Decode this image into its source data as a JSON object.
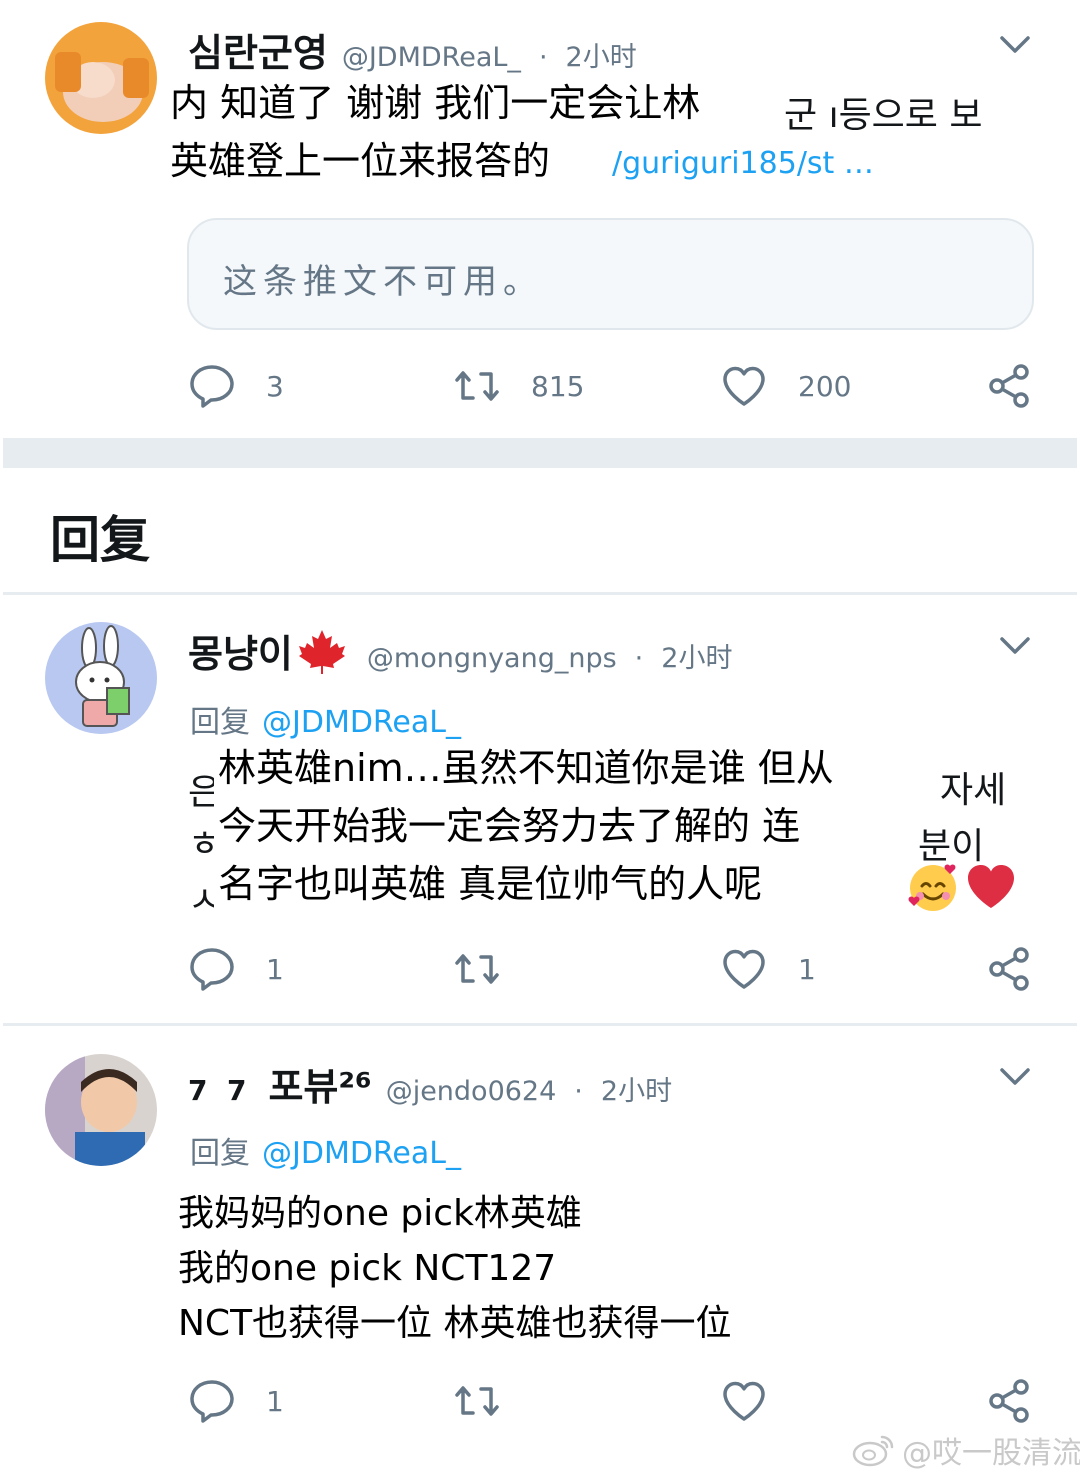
{
  "tweet1": {
    "name": "심란군영",
    "handle": "@JDMDReaL_",
    "dot": "·",
    "time": "2小时",
    "lines": [
      "内 知道了 谢谢 我们一定会让林",
      "英雄登上一位来报答的"
    ],
    "behind": [
      "군 ı등으로 보",
      "/guriguri185/st …"
    ],
    "unavailable": "这条推文不可用。",
    "replies": "3",
    "retweets": "815",
    "likes": "200"
  },
  "section": {
    "title": "回复"
  },
  "tweet2": {
    "name": "몽냥이",
    "handle": "@mongnyang_nps",
    "dot": "·",
    "time": "2小时",
    "reply_label": "回复",
    "reply_mention": "@JDMDReaL_",
    "lines": [
      "林英雄nim…虽然不知道你是谁 但从",
      "今天开始我一定会努力去了解的 连",
      "名字也叫英雄 真是位帅气的人呢"
    ],
    "behind_left": [
      "은",
      "ㅎ",
      "ㅅ"
    ],
    "behind_right": [
      "자세",
      "분이"
    ],
    "replies": "1",
    "likes": "1"
  },
  "tweet3": {
    "name_prefix": "7  7",
    "name": "포뷰²⁶",
    "handle": "@jendo0624",
    "dot": "·",
    "time": "2小时",
    "reply_label": "回复",
    "reply_mention": "@JDMDReaL_",
    "lines": [
      "我妈妈的one pick林英雄",
      "我的one pick NCT127",
      "NCT也获得一位 林英雄也获得一位"
    ],
    "replies": "1"
  },
  "watermark": {
    "text": "@哎一股清流"
  },
  "icons": {
    "reply": "reply-bubble-icon",
    "retweet": "retweet-icon",
    "like": "heart-outline-icon",
    "share": "share-icon",
    "more": "chevron-down-icon",
    "maple": "maple-leaf-icon",
    "emoji1": "smiling-face-with-hearts-icon",
    "emoji2": "red-heart-icon"
  },
  "colors": {
    "link": "#1da1f2",
    "secondary": "#657786",
    "divider": "#e6ecf0",
    "maple": "#e0242b",
    "heart": "#e0245e"
  }
}
